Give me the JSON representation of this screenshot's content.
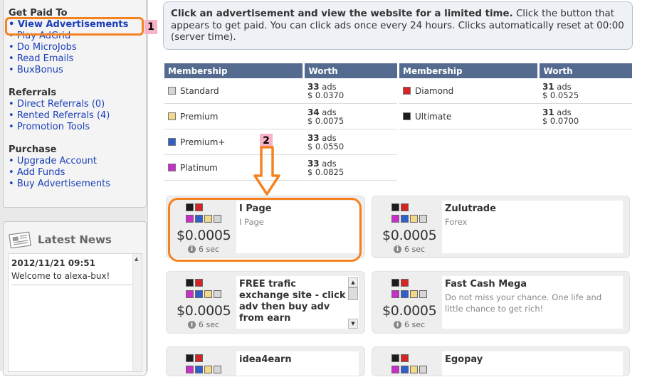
{
  "sidebar": {
    "sections": [
      {
        "title": "Get Paid To",
        "items": [
          {
            "label": "View Advertisements",
            "count": ""
          },
          {
            "label": "Play AdGrid",
            "count": ""
          },
          {
            "label": "Do MicroJobs",
            "count": ""
          },
          {
            "label": "Read Emails",
            "count": ""
          },
          {
            "label": "BuxBonus",
            "count": ""
          }
        ]
      },
      {
        "title": "Referrals",
        "items": [
          {
            "label": "Direct Referrals",
            "count": "(0)"
          },
          {
            "label": "Rented Referrals",
            "count": "(4)"
          },
          {
            "label": "Promotion Tools",
            "count": ""
          }
        ]
      },
      {
        "title": "Purchase",
        "items": [
          {
            "label": "Upgrade Account",
            "count": ""
          },
          {
            "label": "Add Funds",
            "count": ""
          },
          {
            "label": "Buy Advertisements",
            "count": ""
          }
        ]
      }
    ],
    "news": {
      "title": "Latest News",
      "date": "2012/11/21 09:51",
      "text": "Welcome to alexa-bux!"
    }
  },
  "info": {
    "bold": "Click an advertisement and view the website for a limited time.",
    "text": " Click the button that appears to get paid. You can click ads once every 24 hours. Clicks automatically reset at 00:00 (server time)."
  },
  "table": {
    "col_membership": "Membership",
    "col_worth": "Worth",
    "left": [
      {
        "name": "Standard",
        "color": "#d6d6d6",
        "ads": "33",
        "ads_unit": "ads",
        "amount": "$ 0.0370"
      },
      {
        "name": "Premium",
        "color": "#f2d98a",
        "ads": "34",
        "ads_unit": "ads",
        "amount": "$ 0.0075"
      },
      {
        "name": "Premium+",
        "color": "#2f5fc8",
        "ads": "33",
        "ads_unit": "ads",
        "amount": "$ 0.0550"
      },
      {
        "name": "Platinum",
        "color": "#c82ec8",
        "ads": "33",
        "ads_unit": "ads",
        "amount": "$ 0.0825"
      }
    ],
    "right": [
      {
        "name": "Diamond",
        "color": "#d52424",
        "ads": "31",
        "ads_unit": "ads",
        "amount": "$ 0.0525"
      },
      {
        "name": "Ultimate",
        "color": "#1c1c1c",
        "ads": "31",
        "ads_unit": "ads",
        "amount": "$ 0.0700"
      }
    ]
  },
  "ads": [
    {
      "title": "I Page",
      "desc": "I Page",
      "price": "$0.0005",
      "duration": "6 sec"
    },
    {
      "title": "Zulutrade",
      "desc": "Forex",
      "price": "$0.0005",
      "duration": "6 sec"
    },
    {
      "title": "FREE trafic exchange site - click adv then buy adv from earn",
      "desc": "",
      "price": "$0.0005",
      "duration": "6 sec"
    },
    {
      "title": "Fast Cash Mega",
      "desc": "Do not miss your chance. One life and little chance to get rich!",
      "price": "$0.0005",
      "duration": "6 sec"
    },
    {
      "title": "idea4earn",
      "desc": "",
      "price": "",
      "duration": ""
    },
    {
      "title": "Egopay",
      "desc": "",
      "price": "",
      "duration": ""
    }
  ],
  "annotations": {
    "marker1": "1",
    "marker2": "2",
    "color": "#f58220"
  },
  "membership_icon_colors": [
    "#1c1c1c",
    "#d52424",
    "#c82ec8",
    "#2f5fc8",
    "#f2d98a",
    "#d6d6d6"
  ]
}
